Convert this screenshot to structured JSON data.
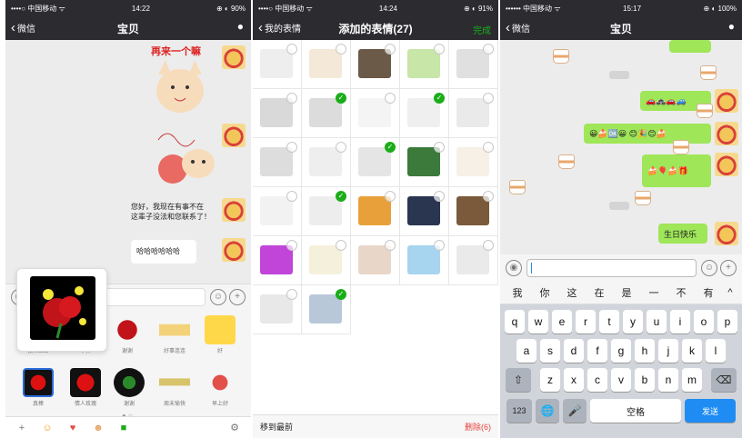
{
  "status": {
    "left": {
      "carrier": "••••○ 中国移动 ᯤ",
      "time": "14:22",
      "battery": "⊕ ◐ 90%"
    },
    "mid": {
      "carrier": "••••○ 中国移动 ᯤ",
      "time": "14:24",
      "battery": "⊕ ◐ 91%"
    },
    "right": {
      "carrier": "•••••• 中国移动 ᯤ",
      "time": "15:17",
      "battery": "⊕ ◐ 100%"
    }
  },
  "screen1": {
    "back_label": "微信",
    "title": "宝贝",
    "sticker_caption": "再来一个嘛",
    "messages": [
      "您好，我现在有事不在\n这辈子没法和您联系了！",
      "哈哈哈哈哈哈"
    ],
    "sticker_labels": [
      "摸...么么",
      "干杯",
      "谢谢",
      "好事连连",
      "好",
      "真棒",
      "情人玫瑰",
      "谢谢",
      "周末愉快",
      "早上好"
    ],
    "tray_icons": [
      "plus-icon",
      "smile-icon",
      "heart-icon",
      "cat-icon",
      "green-sticker-icon",
      "gear-icon"
    ],
    "tray_glyphs": [
      "+",
      "☺",
      "♥",
      "☻",
      "■",
      "⚙"
    ]
  },
  "screen2": {
    "back_label": "我的表情",
    "title": "添加的表情(27)",
    "done_label": "完成",
    "bottom_left": "移到最前",
    "bottom_right": "删除(6)",
    "grid_checked": [
      false,
      false,
      false,
      false,
      false,
      false,
      true,
      false,
      true,
      false,
      false,
      false,
      true,
      false,
      false,
      false,
      true,
      false,
      false,
      false,
      false,
      false,
      false,
      false,
      false,
      false,
      true
    ]
  },
  "screen3": {
    "back_label": "微信",
    "title": "宝贝",
    "message": "生日快乐",
    "candidates": [
      "我",
      "你",
      "这",
      "在",
      "是",
      "一",
      "不",
      "有"
    ],
    "rows": [
      [
        "q",
        "w",
        "e",
        "r",
        "t",
        "y",
        "u",
        "i",
        "o",
        "p"
      ],
      [
        "a",
        "s",
        "d",
        "f",
        "g",
        "h",
        "j",
        "k",
        "l"
      ],
      [
        "z",
        "x",
        "c",
        "v",
        "b",
        "n",
        "m"
      ]
    ],
    "key_123": "123",
    "key_space": "空格",
    "key_send": "发送",
    "globe_glyph": "🌐",
    "mic_glyph": "🎤",
    "shift_glyph": "⇧",
    "delete_glyph": "⌫",
    "collapse_glyph": "^"
  }
}
